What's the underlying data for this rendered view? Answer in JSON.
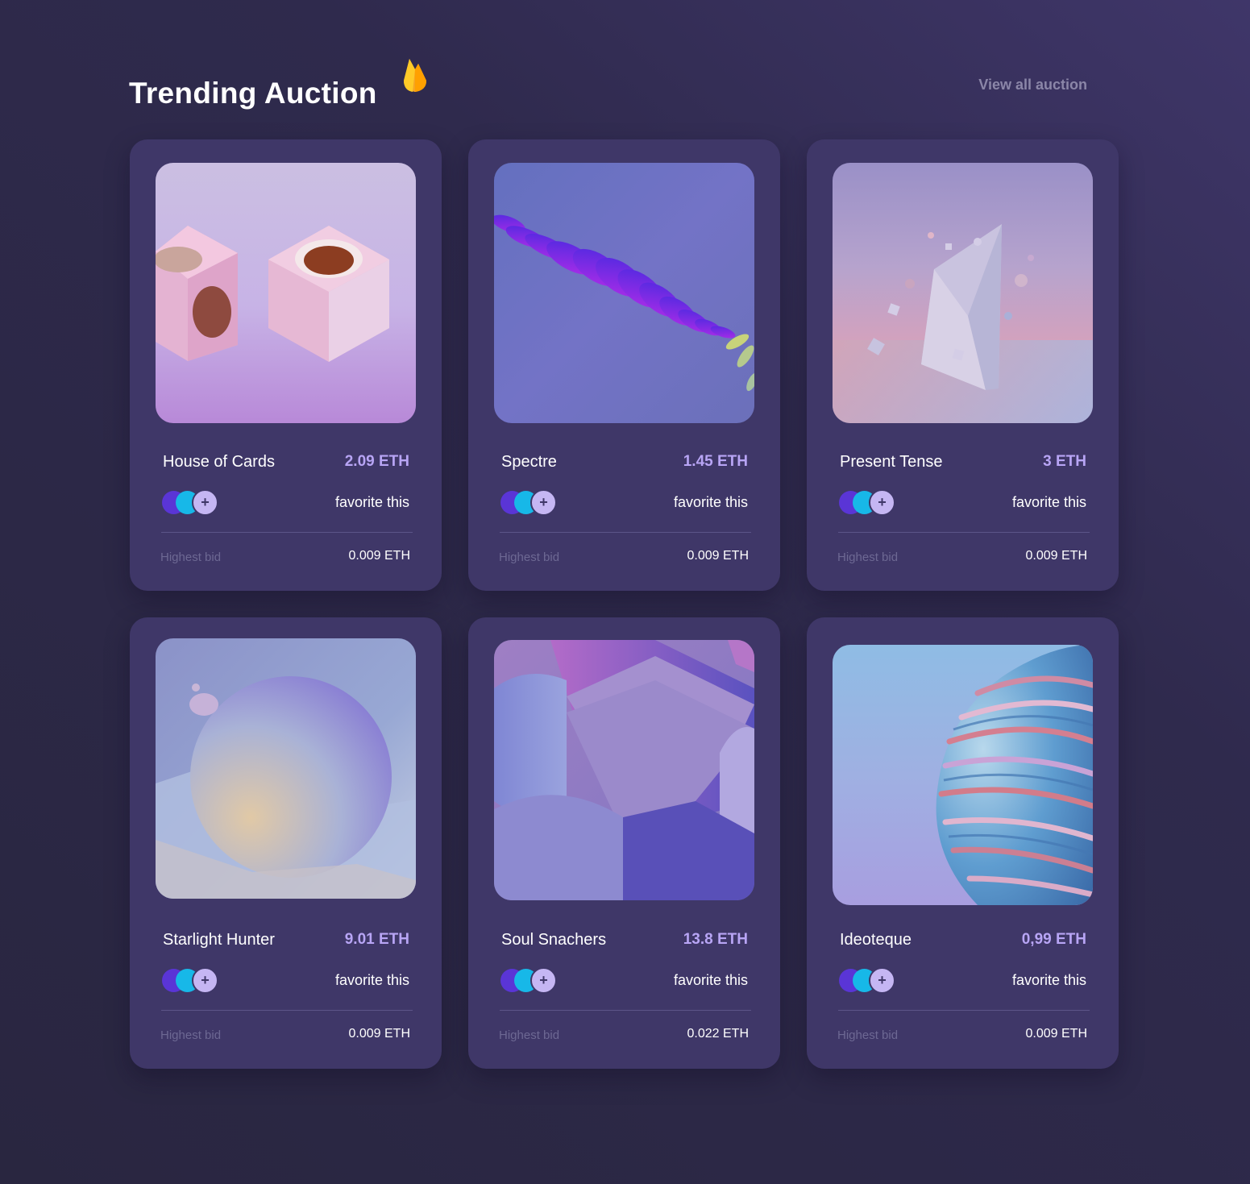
{
  "header": {
    "title": "Trending Auction",
    "icon": "flame-icon",
    "view_all_label": "View all auction"
  },
  "colors": {
    "background": "#2f2a4d",
    "card": "#3f3768",
    "price_accent": "#b8a5f5",
    "muted_text": "#6d6893"
  },
  "cards": [
    {
      "title": "House of Cards",
      "price": "2.09 ETH",
      "favorite_label": "favorite this",
      "bid_label": "Highest bid",
      "bid_value": "0.009 ETH",
      "add_icon": "+"
    },
    {
      "title": "Spectre",
      "price": "1.45 ETH",
      "favorite_label": "favorite this",
      "bid_label": "Highest bid",
      "bid_value": "0.009 ETH",
      "add_icon": "+"
    },
    {
      "title": "Present Tense",
      "price": "3 ETH",
      "favorite_label": "favorite this",
      "bid_label": "Highest bid",
      "bid_value": "0.009 ETH",
      "add_icon": "+"
    },
    {
      "title": "Starlight Hunter",
      "price": "9.01 ETH",
      "favorite_label": "favorite this",
      "bid_label": "Highest bid",
      "bid_value": "0.009 ETH",
      "add_icon": "+"
    },
    {
      "title": "Soul Snachers",
      "price": "13.8 ETH",
      "favorite_label": "favorite this",
      "bid_label": "Highest bid",
      "bid_value": "0.022 ETH",
      "add_icon": "+"
    },
    {
      "title": "Ideoteque",
      "price": "0,99 ETH",
      "favorite_label": "favorite this",
      "bid_label": "Highest bid",
      "bid_value": "0.009 ETH",
      "add_icon": "+"
    }
  ]
}
